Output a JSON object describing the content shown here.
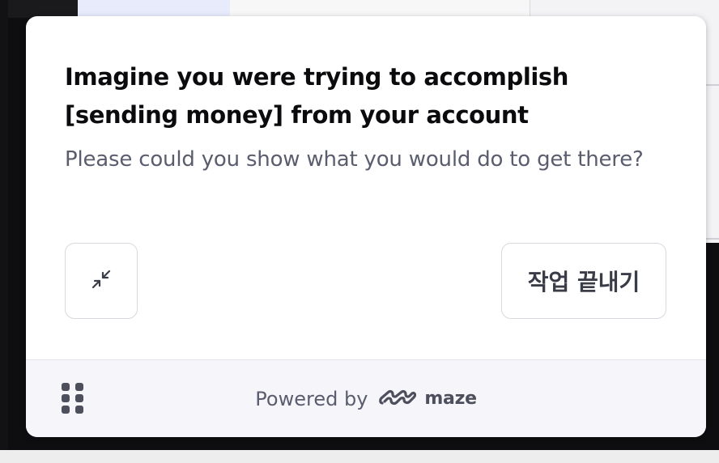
{
  "prompt": {
    "title_line1": "Imagine you were trying to accomplish",
    "title_line2": "[sending money] from your account",
    "subtitle": "Please could you show what you would do to get there?"
  },
  "actions": {
    "minimize_icon": "minimize-arrows-icon",
    "finish_label": "작업 끝내기"
  },
  "footer": {
    "drag_icon": "drag-handle-icon",
    "powered_by": "Powered by",
    "brand": "maze",
    "brand_icon": "maze-logo-icon"
  },
  "colors": {
    "title": "#0b0b0d",
    "subtitle": "#5a5d6e",
    "footer_bg": "#f5f5fa",
    "border": "#d8d9de"
  }
}
